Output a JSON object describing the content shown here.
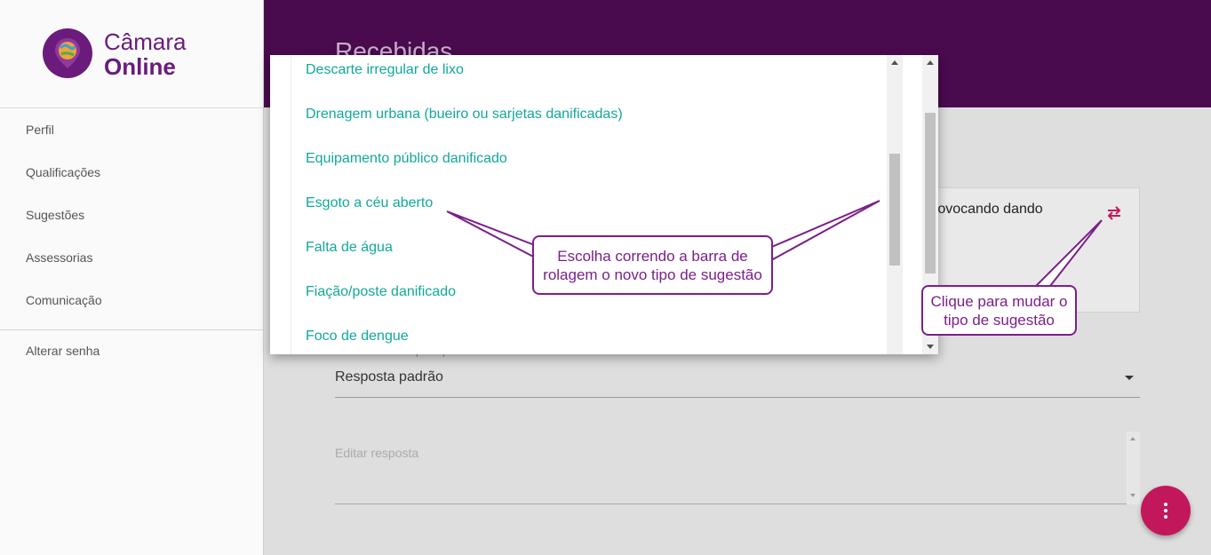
{
  "app": {
    "logo_line1": "Câmara",
    "logo_line2": "Online",
    "brand_color": "#6a1b7c",
    "header_color": "#4a0a4e"
  },
  "sidebar": {
    "items": [
      {
        "label": "Perfil"
      },
      {
        "label": "Qualificações"
      },
      {
        "label": "Sugestões"
      },
      {
        "label": "Assessorias"
      },
      {
        "label": "Comunicação"
      },
      {
        "label": "Alterar senha"
      }
    ]
  },
  "header": {
    "title": "Recebidas"
  },
  "card": {
    "text": "rovocando dando",
    "icon": "swap-icon"
  },
  "response": {
    "label": "Selecione uma resposta padrão",
    "value": "Resposta padrão",
    "editor_placeholder": "Editar resposta"
  },
  "dropdown": {
    "options": [
      "Descarte irregular de lixo",
      "Drenagem urbana (bueiro ou sarjetas danificadas)",
      "Equipamento público danificado",
      "Esgoto a céu aberto",
      "Falta de água",
      "Fiação/poste danificado",
      "Foco de dengue"
    ],
    "option_color": "#12a89a"
  },
  "annotations": {
    "scroll_hint_line1": "Escolha correndo a barra de",
    "scroll_hint_line2": "rolagem o novo tipo de sugestão",
    "change_hint_line1": "Clique para mudar o",
    "change_hint_line2": "tipo de sugestão",
    "color": "#7b1f8a"
  },
  "fab": {
    "icon": "more-vertical-icon",
    "color": "#c2185b"
  }
}
